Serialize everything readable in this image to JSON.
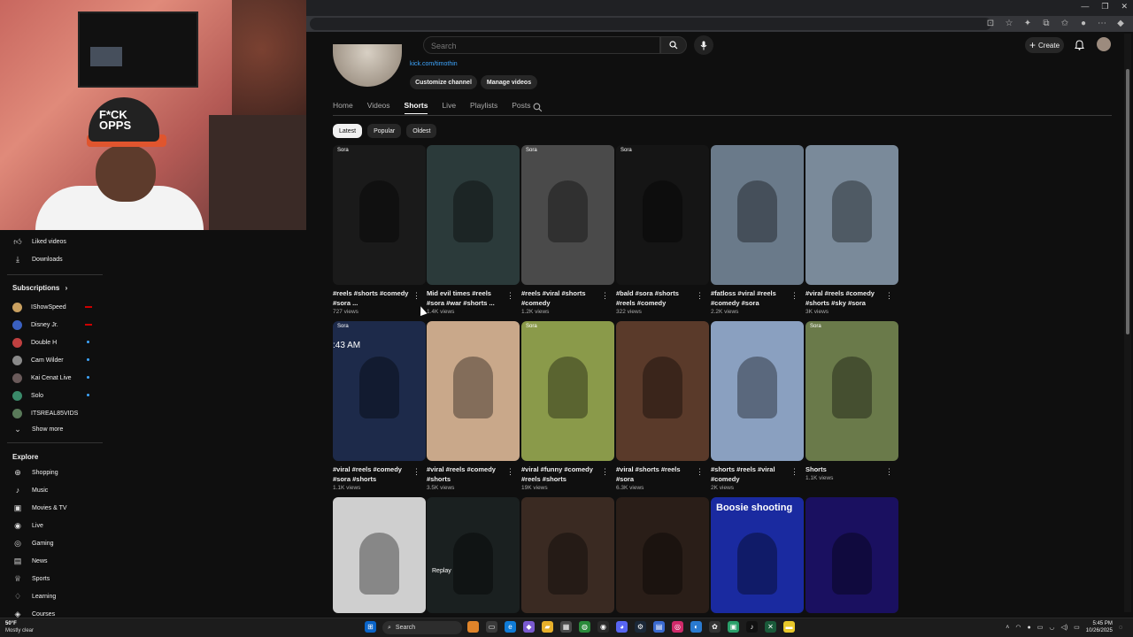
{
  "youtube": {
    "search_placeholder": "Search",
    "create_label": "Create",
    "channel_link": "kick.com/timothin",
    "customize_label": "Customize channel",
    "manage_label": "Manage videos",
    "tabs": [
      "Home",
      "Videos",
      "Shorts",
      "Live",
      "Playlists",
      "Posts"
    ],
    "active_tab": "Shorts",
    "chips": [
      "Latest",
      "Popular",
      "Oldest"
    ],
    "active_chip": "Latest"
  },
  "shorts": [
    {
      "title": "#reels #shorts #comedy #sora ...",
      "views": "727 views",
      "bg": "#1a1a1a",
      "sora": "Sora",
      "overlay": ""
    },
    {
      "title": "Mid evil times #reels #sora #war #shorts ...",
      "views": "1.4K views",
      "bg": "#2b3a3a",
      "sora": "",
      "overlay": ""
    },
    {
      "title": "#reels #viral #shorts #comedy",
      "views": "1.2K views",
      "bg": "#4a4a4a",
      "sora": "Sora",
      "overlay": ""
    },
    {
      "title": "#bald #sora #shorts #reels #comedy",
      "views": "322 views",
      "bg": "#151515",
      "sora": "Sora",
      "overlay": ""
    },
    {
      "title": "#fatloss #viral #reels #comedy #sora",
      "views": "2.2K views",
      "bg": "#6a7a8a",
      "sora": "",
      "overlay": ""
    },
    {
      "title": "#viral #reels #comedy #shorts #sky #sora",
      "views": "3K views",
      "bg": "#7a8a9a",
      "sora": "",
      "overlay": ""
    },
    {
      "title": "#viral #reels #comedy #sora #shorts",
      "views": "1.1K views",
      "bg": "#1d2a4a",
      "sora": "Sora",
      "overlay": ":43 AM"
    },
    {
      "title": "#viral #reels #comedy #shorts",
      "views": "3.5K views",
      "bg": "#c9a88a",
      "sora": "",
      "overlay": ""
    },
    {
      "title": "#viral #funny #comedy #reels #shorts",
      "views": "19K views",
      "bg": "#8a9a4a",
      "sora": "Sora",
      "overlay": ""
    },
    {
      "title": "#viral #shorts #reels #sora",
      "views": "6.3K views",
      "bg": "#5a3a2a",
      "sora": "",
      "overlay": ""
    },
    {
      "title": "#shorts #reels #viral #comedy",
      "views": "2K views",
      "bg": "#8aa0c0",
      "sora": "",
      "overlay": ""
    },
    {
      "title": "Shorts",
      "views": "1.1K views",
      "bg": "#6a7a4a",
      "sora": "Sora",
      "overlay": ""
    },
    {
      "title": "",
      "views": "",
      "bg": "#cfcfcf",
      "sora": "",
      "overlay": ""
    },
    {
      "title": "",
      "views": "",
      "bg": "#1a2020",
      "sora": "",
      "overlay": "Replay"
    },
    {
      "title": "",
      "views": "",
      "bg": "#3a2a22",
      "sora": "",
      "overlay": ""
    },
    {
      "title": "",
      "views": "",
      "bg": "#2a1e18",
      "sora": "",
      "overlay": ""
    },
    {
      "title": "",
      "views": "",
      "bg": "#1a2aa0",
      "sora": "",
      "overlay": "Boosie shooting"
    },
    {
      "title": "",
      "views": "",
      "bg": "#1a1060",
      "sora": "",
      "overlay": ""
    }
  ],
  "sidebar": {
    "liked": "Liked videos",
    "downloads": "Downloads",
    "subscriptions_heading": "Subscriptions",
    "subscriptions": [
      {
        "name": "IShowSpeed",
        "color": "#c9a060",
        "status": "live"
      },
      {
        "name": "Disney Jr.",
        "color": "#3a60c0",
        "status": "live"
      },
      {
        "name": "Double H",
        "color": "#c04040",
        "status": "dot"
      },
      {
        "name": "Cam Wilder",
        "color": "#8a8a8a",
        "status": "dot"
      },
      {
        "name": "Kai Cenat Live",
        "color": "#6a5a5a",
        "status": "dot"
      },
      {
        "name": "Solo",
        "color": "#3a8a6a",
        "status": "dot"
      },
      {
        "name": "ITSREAL85VIDS",
        "color": "#5a7a5a",
        "status": ""
      }
    ],
    "show_more": "Show more",
    "explore_heading": "Explore",
    "explore": [
      {
        "label": "Shopping",
        "icon": "shopping-bag-icon",
        "glyph": "⊕"
      },
      {
        "label": "Music",
        "icon": "music-icon",
        "glyph": "♪"
      },
      {
        "label": "Movies & TV",
        "icon": "movies-icon",
        "glyph": "▣"
      },
      {
        "label": "Live",
        "icon": "live-icon",
        "glyph": "◉"
      },
      {
        "label": "Gaming",
        "icon": "gaming-icon",
        "glyph": "◎"
      },
      {
        "label": "News",
        "icon": "news-icon",
        "glyph": "▤"
      },
      {
        "label": "Sports",
        "icon": "trophy-icon",
        "glyph": "♕"
      },
      {
        "label": "Learning",
        "icon": "learning-icon",
        "glyph": "♢"
      },
      {
        "label": "Courses",
        "icon": "courses-icon",
        "glyph": "◈"
      }
    ]
  },
  "webcam": {
    "hat_text_line1": "F*CK",
    "hat_text_line2": "OPPS"
  },
  "taskbar": {
    "temp": "50°F",
    "weather": "Mostly clear",
    "search": "Search",
    "time": "5:45 PM",
    "date": "10/26/2025"
  }
}
